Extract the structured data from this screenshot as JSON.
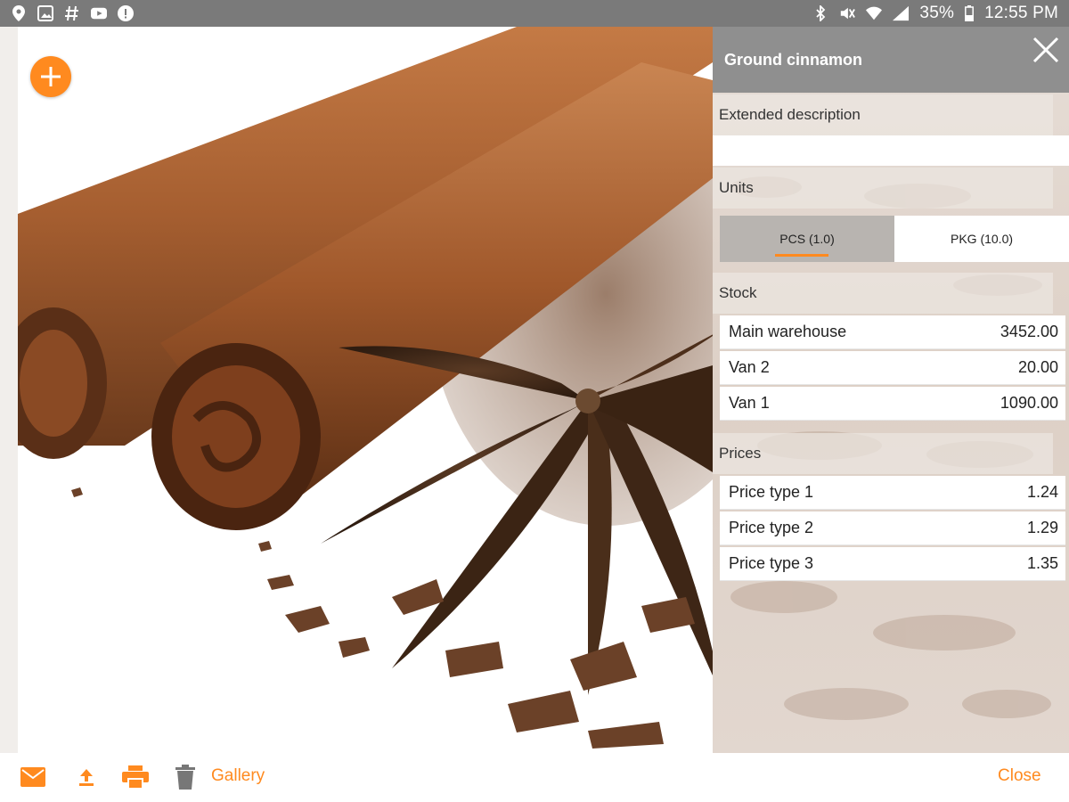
{
  "status_bar": {
    "left_icons": [
      "location-icon",
      "image-icon",
      "hash-icon",
      "youtube-icon",
      "alert-icon"
    ],
    "right_icons": [
      "bluetooth-icon",
      "mute-icon",
      "wifi-icon",
      "signal-icon",
      "battery-icon"
    ],
    "battery": "35%",
    "time": "12:55 PM"
  },
  "colors": {
    "accent": "#ff8a1f",
    "header": "#8f8f8f",
    "statusbar": "#7a7a7a"
  },
  "product": {
    "title": "Ground cinnamon"
  },
  "sections": {
    "extended_description": "Extended description",
    "units": "Units",
    "stock": "Stock",
    "prices": "Prices"
  },
  "units": [
    {
      "label": "PCS (1.0)",
      "selected": true
    },
    {
      "label": "PKG (10.0)",
      "selected": false
    }
  ],
  "stock": [
    {
      "name": "Main warehouse",
      "value": "3452.00"
    },
    {
      "name": "Van 2",
      "value": "20.00"
    },
    {
      "name": "Van 1",
      "value": "1090.00"
    }
  ],
  "prices": [
    {
      "name": "Price type 1",
      "value": "1.24"
    },
    {
      "name": "Price type 2",
      "value": "1.29"
    },
    {
      "name": "Price type 3",
      "value": "1.35"
    }
  ],
  "toolbar": {
    "icons": [
      "email-icon",
      "upload-icon",
      "print-icon",
      "trash-icon"
    ],
    "gallery_label": "Gallery",
    "close_label": "Close"
  }
}
